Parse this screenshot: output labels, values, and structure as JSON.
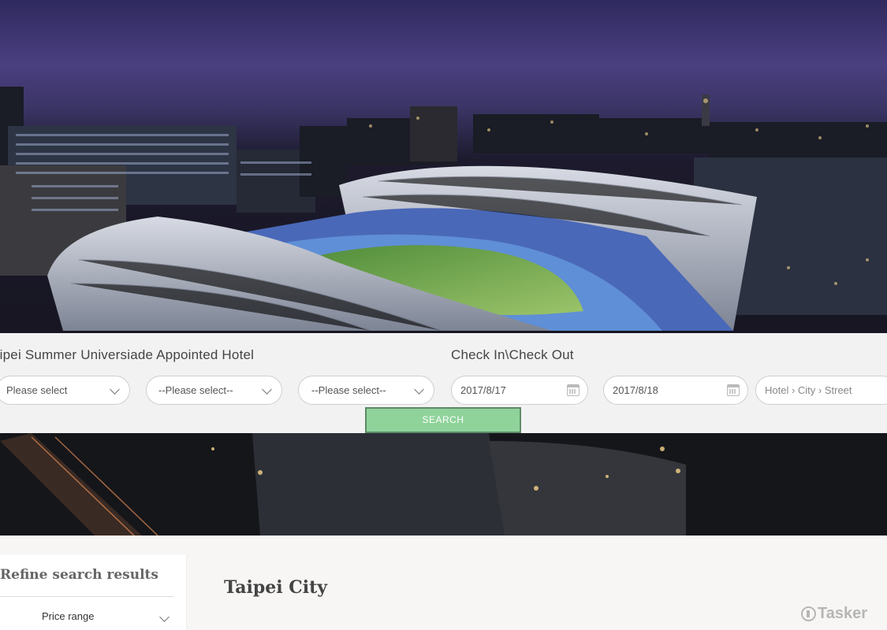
{
  "hero": {
    "image": "night-stadium-aerial-photo"
  },
  "search_panel": {
    "hotel_heading": "aipei Summer Universiade Appointed Hotel",
    "date_heading": "Check In\\Check Out",
    "select_1": "Please select",
    "select_2": "--Please select--",
    "select_3": "--Please select--",
    "check_in": "2017/8/17",
    "check_out": "2017/8/18",
    "keyword_placeholder": "Hotel › City › Street",
    "search_label": "SEARCH",
    "accent_color": "#8fd39b"
  },
  "sidebar": {
    "title": "Refine search results",
    "price_range_label": "Price range"
  },
  "main": {
    "city_title": "Taipei City"
  },
  "watermark": {
    "text": "Tasker"
  }
}
